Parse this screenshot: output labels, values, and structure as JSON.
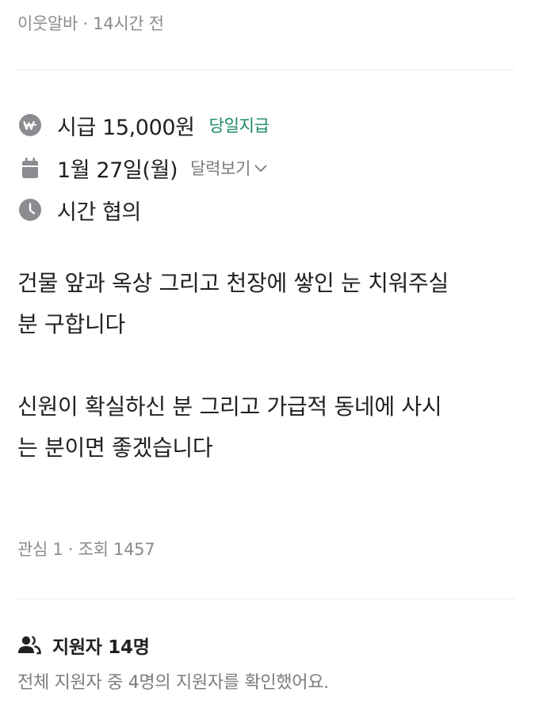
{
  "header": {
    "category": "이웃알바",
    "separator": " · ",
    "posted_time": "14시간 전"
  },
  "info": {
    "wage": {
      "icon": "won-icon",
      "text": "시급 15,000원",
      "badge": "당일지급",
      "badge_color": "#1a8a66"
    },
    "date": {
      "icon": "calendar-icon",
      "text": "1월 27일(월)",
      "calendar_link": "달력보기"
    },
    "time": {
      "icon": "clock-icon",
      "text": "시간 협의"
    }
  },
  "description": {
    "paragraph1_line1": "건물 앞과 옥상 그리고 천장에 쌓인 눈 치워주실",
    "paragraph1_line2": "분 구합니다",
    "paragraph2_line1": "신원이 확실하신 분 그리고 가급적 동네에 사시",
    "paragraph2_line2": "는 분이면 좋겠습니다"
  },
  "stats": {
    "text": "관심 1 · 조회 1457"
  },
  "applicants": {
    "icon": "people-icon",
    "title": "지원자 14명",
    "note": "전체 지원자 중 4명의 지원자를 확인했어요."
  },
  "colors": {
    "icon_gray": "#8b8b90",
    "text_primary": "#212124",
    "text_secondary": "#8b8b90",
    "accent_green": "#1a8a66"
  }
}
